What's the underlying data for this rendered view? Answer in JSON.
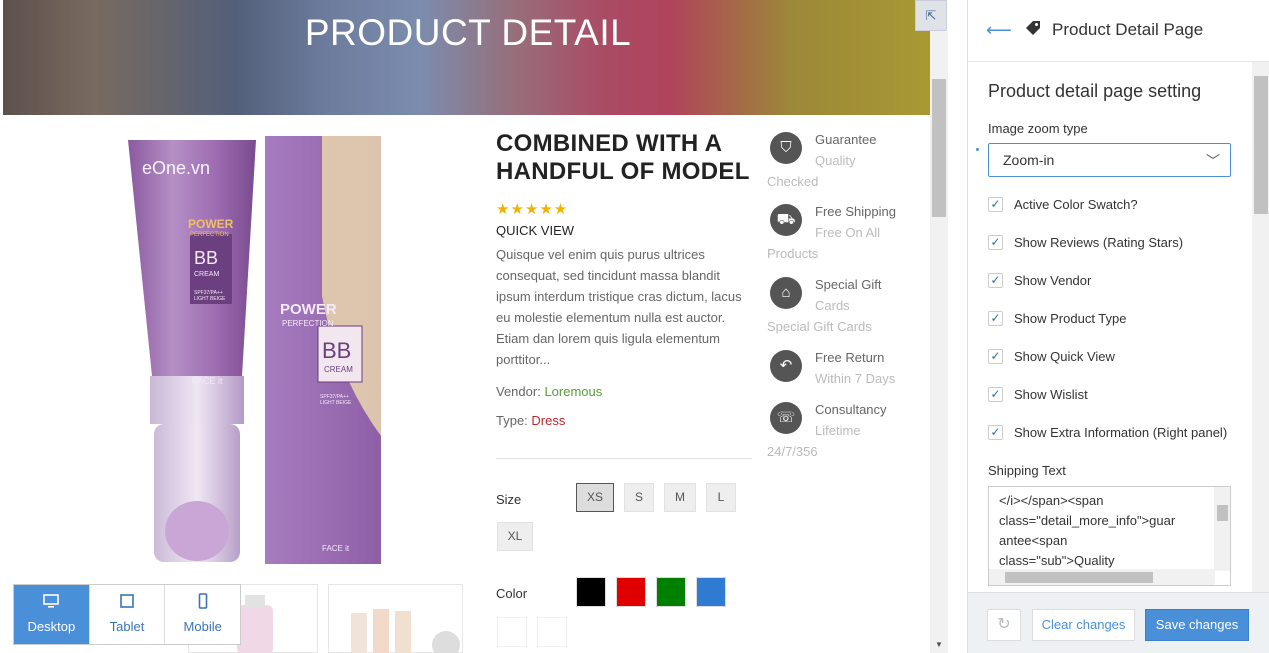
{
  "hero": {
    "title": "PRODUCT DETAIL"
  },
  "product": {
    "watermark": "eOne.vn",
    "tube_text": {
      "brand": "POWER",
      "line2": "PERFECTION",
      "bb": "BB",
      "cream": "CREAM",
      "spf": "SPF37/PA++",
      "shade": "LIGHT BEIGE",
      "logo": "FACE it"
    },
    "box_text": {
      "brand": "POWER",
      "line2": "PERFECTION",
      "bb": "BB",
      "cream": "CREAM",
      "spf": "SPF37/PA++",
      "shade": "LIGHT BEIGE",
      "logo": "FACE it"
    },
    "title": "COMBINED WITH A HANDFUL OF MODEL",
    "stars": "★★★★★",
    "quick_view": "QUICK VIEW",
    "description": "Quisque vel enim quis purus ultrices consequat, sed tincidunt massa blandit ipsum interdum tristique cras dictum, lacus eu molestie elementum nulla est auctor. Etiam dan lorem quis ligula elementum porttitor...",
    "vendor_label": "Vendor:",
    "vendor_value": "Loremous",
    "type_label": "Type:",
    "type_value": "Dress",
    "size_label": "Size",
    "sizes": [
      "XS",
      "S",
      "M",
      "L",
      "XL"
    ],
    "selected_size": "XS",
    "color_label": "Color",
    "colors": [
      "#000000",
      "#e00000",
      "#008000",
      "#2e7bd1",
      "#ffffff",
      "#ffffff"
    ]
  },
  "features": [
    {
      "icon": "shield-icon",
      "glyph": "⛉",
      "title": "Guarantee",
      "sub": "Quality",
      "sub2": "Checked"
    },
    {
      "icon": "truck-icon",
      "glyph": "⛟",
      "title": "Free Shipping",
      "sub": "Free On All",
      "sub2": "Products"
    },
    {
      "icon": "gift-icon",
      "glyph": "⌂",
      "title": "Special Gift",
      "sub": "Cards",
      "sub2": "Special Gift Cards"
    },
    {
      "icon": "return-icon",
      "glyph": "↶",
      "title": "Free Return",
      "sub": "Within 7 Days",
      "sub2": ""
    },
    {
      "icon": "phone-icon",
      "glyph": "☏",
      "title": "Consultancy",
      "sub": "Lifetime",
      "sub2": "24/7/356"
    }
  ],
  "devices": [
    {
      "label": "Desktop",
      "icon": "desktop-icon",
      "active": true
    },
    {
      "label": "Tablet",
      "icon": "tablet-icon",
      "active": false
    },
    {
      "label": "Mobile",
      "icon": "mobile-icon",
      "active": false
    }
  ],
  "panel": {
    "title": "Product Detail Page",
    "section": "Product detail page setting",
    "zoom_label": "Image zoom type",
    "zoom_value": "Zoom-in",
    "checkboxes": [
      "Active Color Swatch?",
      "Show Reviews (Rating Stars)",
      "Show Vendor",
      "Show Product Type",
      "Show Quick View",
      "Show Wislist",
      "Show Extra Information (Right panel)"
    ],
    "shipping_label": "Shipping Text",
    "shipping_lines": [
      "</i></span><span",
      "class=\"detail_more_info\">guar",
      "antee<span",
      "class=\"sub\">Quality"
    ],
    "clear_label": "Clear changes",
    "save_label": "Save changes"
  }
}
